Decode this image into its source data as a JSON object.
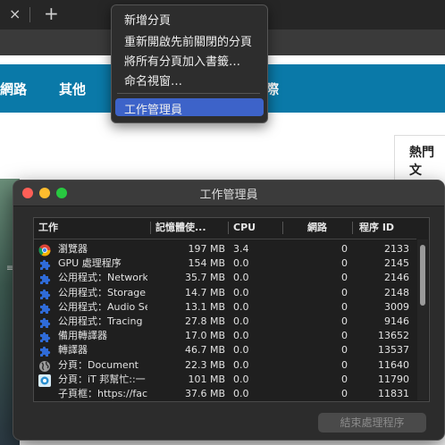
{
  "browser": {
    "tab_close": "×",
    "tab_new": "+",
    "nav_items": [
      "網路",
      "其他",
      "際"
    ],
    "sidebar_title": "熱門文"
  },
  "context_menu": {
    "items": [
      "新增分頁",
      "重新開啟先前關閉的分頁",
      "將所有分頁加入書籤…",
      "命名視窗…",
      "工作管理員"
    ],
    "highlighted_index": 4
  },
  "task_manager": {
    "title": "工作管理員",
    "columns": [
      "工作",
      "記憶體使...",
      "CPU",
      "網路",
      "程序 ID"
    ],
    "rows": [
      {
        "icon": "chrome-icon",
        "task": "瀏覽器",
        "memory": "197 MB",
        "cpu": "3.4",
        "network": "0",
        "pid": "2133"
      },
      {
        "icon": "puzzle-icon",
        "task": "GPU 處理程序",
        "memory": "154 MB",
        "cpu": "0.0",
        "network": "0",
        "pid": "2145"
      },
      {
        "icon": "puzzle-icon",
        "task": "公用程式：Network",
        "memory": "35.7 MB",
        "cpu": "0.0",
        "network": "0",
        "pid": "2146"
      },
      {
        "icon": "puzzle-icon",
        "task": "公用程式：Storage",
        "memory": "14.7 MB",
        "cpu": "0.0",
        "network": "0",
        "pid": "2148"
      },
      {
        "icon": "puzzle-icon",
        "task": "公用程式：Audio Se",
        "memory": "13.1 MB",
        "cpu": "0.0",
        "network": "0",
        "pid": "3009"
      },
      {
        "icon": "puzzle-icon",
        "task": "公用程式：Tracing",
        "memory": "27.8 MB",
        "cpu": "0.0",
        "network": "0",
        "pid": "9146"
      },
      {
        "icon": "puzzle-icon",
        "task": "備用轉譯器",
        "memory": "17.0 MB",
        "cpu": "0.0",
        "network": "0",
        "pid": "13652"
      },
      {
        "icon": "puzzle-icon",
        "task": "轉譯器",
        "memory": "46.7 MB",
        "cpu": "0.0",
        "network": "0",
        "pid": "13537"
      },
      {
        "icon": "globe-icon",
        "task": "分頁：Document",
        "memory": "22.3 MB",
        "cpu": "0.0",
        "network": "0",
        "pid": "11640"
      },
      {
        "icon": "ithome-icon",
        "task": "分頁：iT 邦幫忙::一",
        "memory": "101 MB",
        "cpu": "0.0",
        "network": "0",
        "pid": "11790"
      },
      {
        "icon": "",
        "task": "子頁框：https://fac",
        "memory": "37.6 MB",
        "cpu": "0.0",
        "network": "0",
        "pid": "11831"
      }
    ],
    "end_process_label": "結束處理程序"
  },
  "colors": {
    "nav_bar": "#0a79a8",
    "menu_highlight": "#3d63c9",
    "close_light": "#fe5f57",
    "min_light": "#febc2e",
    "max_light": "#28c840",
    "puzzle_blue": "#2f6bd8"
  }
}
